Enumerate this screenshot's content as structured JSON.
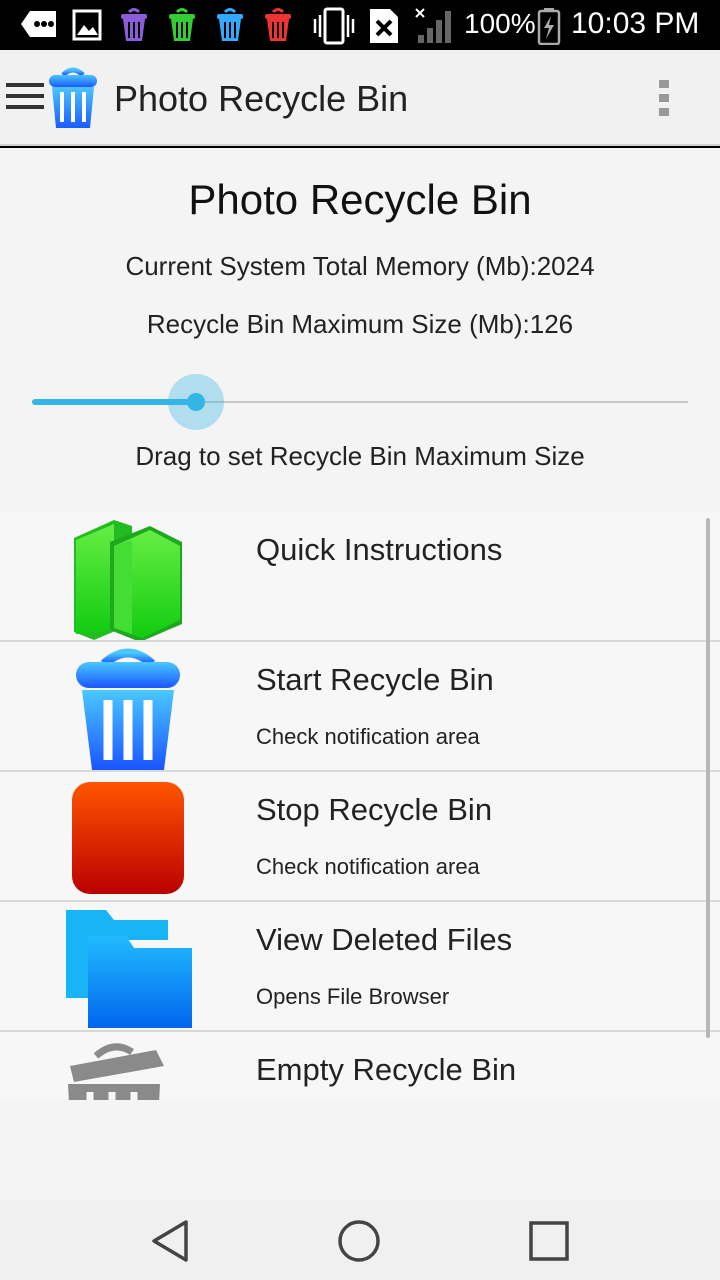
{
  "status_bar": {
    "battery": "100%",
    "time": "10:03 PM"
  },
  "action_bar": {
    "title": "Photo Recycle Bin"
  },
  "main": {
    "title": "Photo Recycle Bin",
    "memory_text": "Current System Total Memory (Mb):2024",
    "max_size_text": "Recycle Bin Maximum Size (Mb):126",
    "slider_fraction": 0.25,
    "slider_hint": "Drag to set Recycle Bin Maximum Size"
  },
  "list": [
    {
      "title": "Quick Instructions",
      "subtitle": "",
      "icon": "green-books-icon"
    },
    {
      "title": "Start Recycle Bin",
      "subtitle": "Check notification area",
      "icon": "blue-trash-bin-icon"
    },
    {
      "title": "Stop Recycle Bin",
      "subtitle": "Check notification area",
      "icon": "red-stop-icon"
    },
    {
      "title": "View Deleted Files",
      "subtitle": "Opens File Browser",
      "icon": "blue-folder-icon"
    },
    {
      "title": "Empty Recycle Bin",
      "subtitle": "",
      "icon": "gray-trash-bin-icon"
    }
  ],
  "colors": {
    "accent": "#33b5e5",
    "quick_instructions": "#33dd22",
    "start_bin": "#1e90ff",
    "stop_bin": "#dd3300",
    "folder": "#1a8cff",
    "empty_bin": "#888888"
  }
}
